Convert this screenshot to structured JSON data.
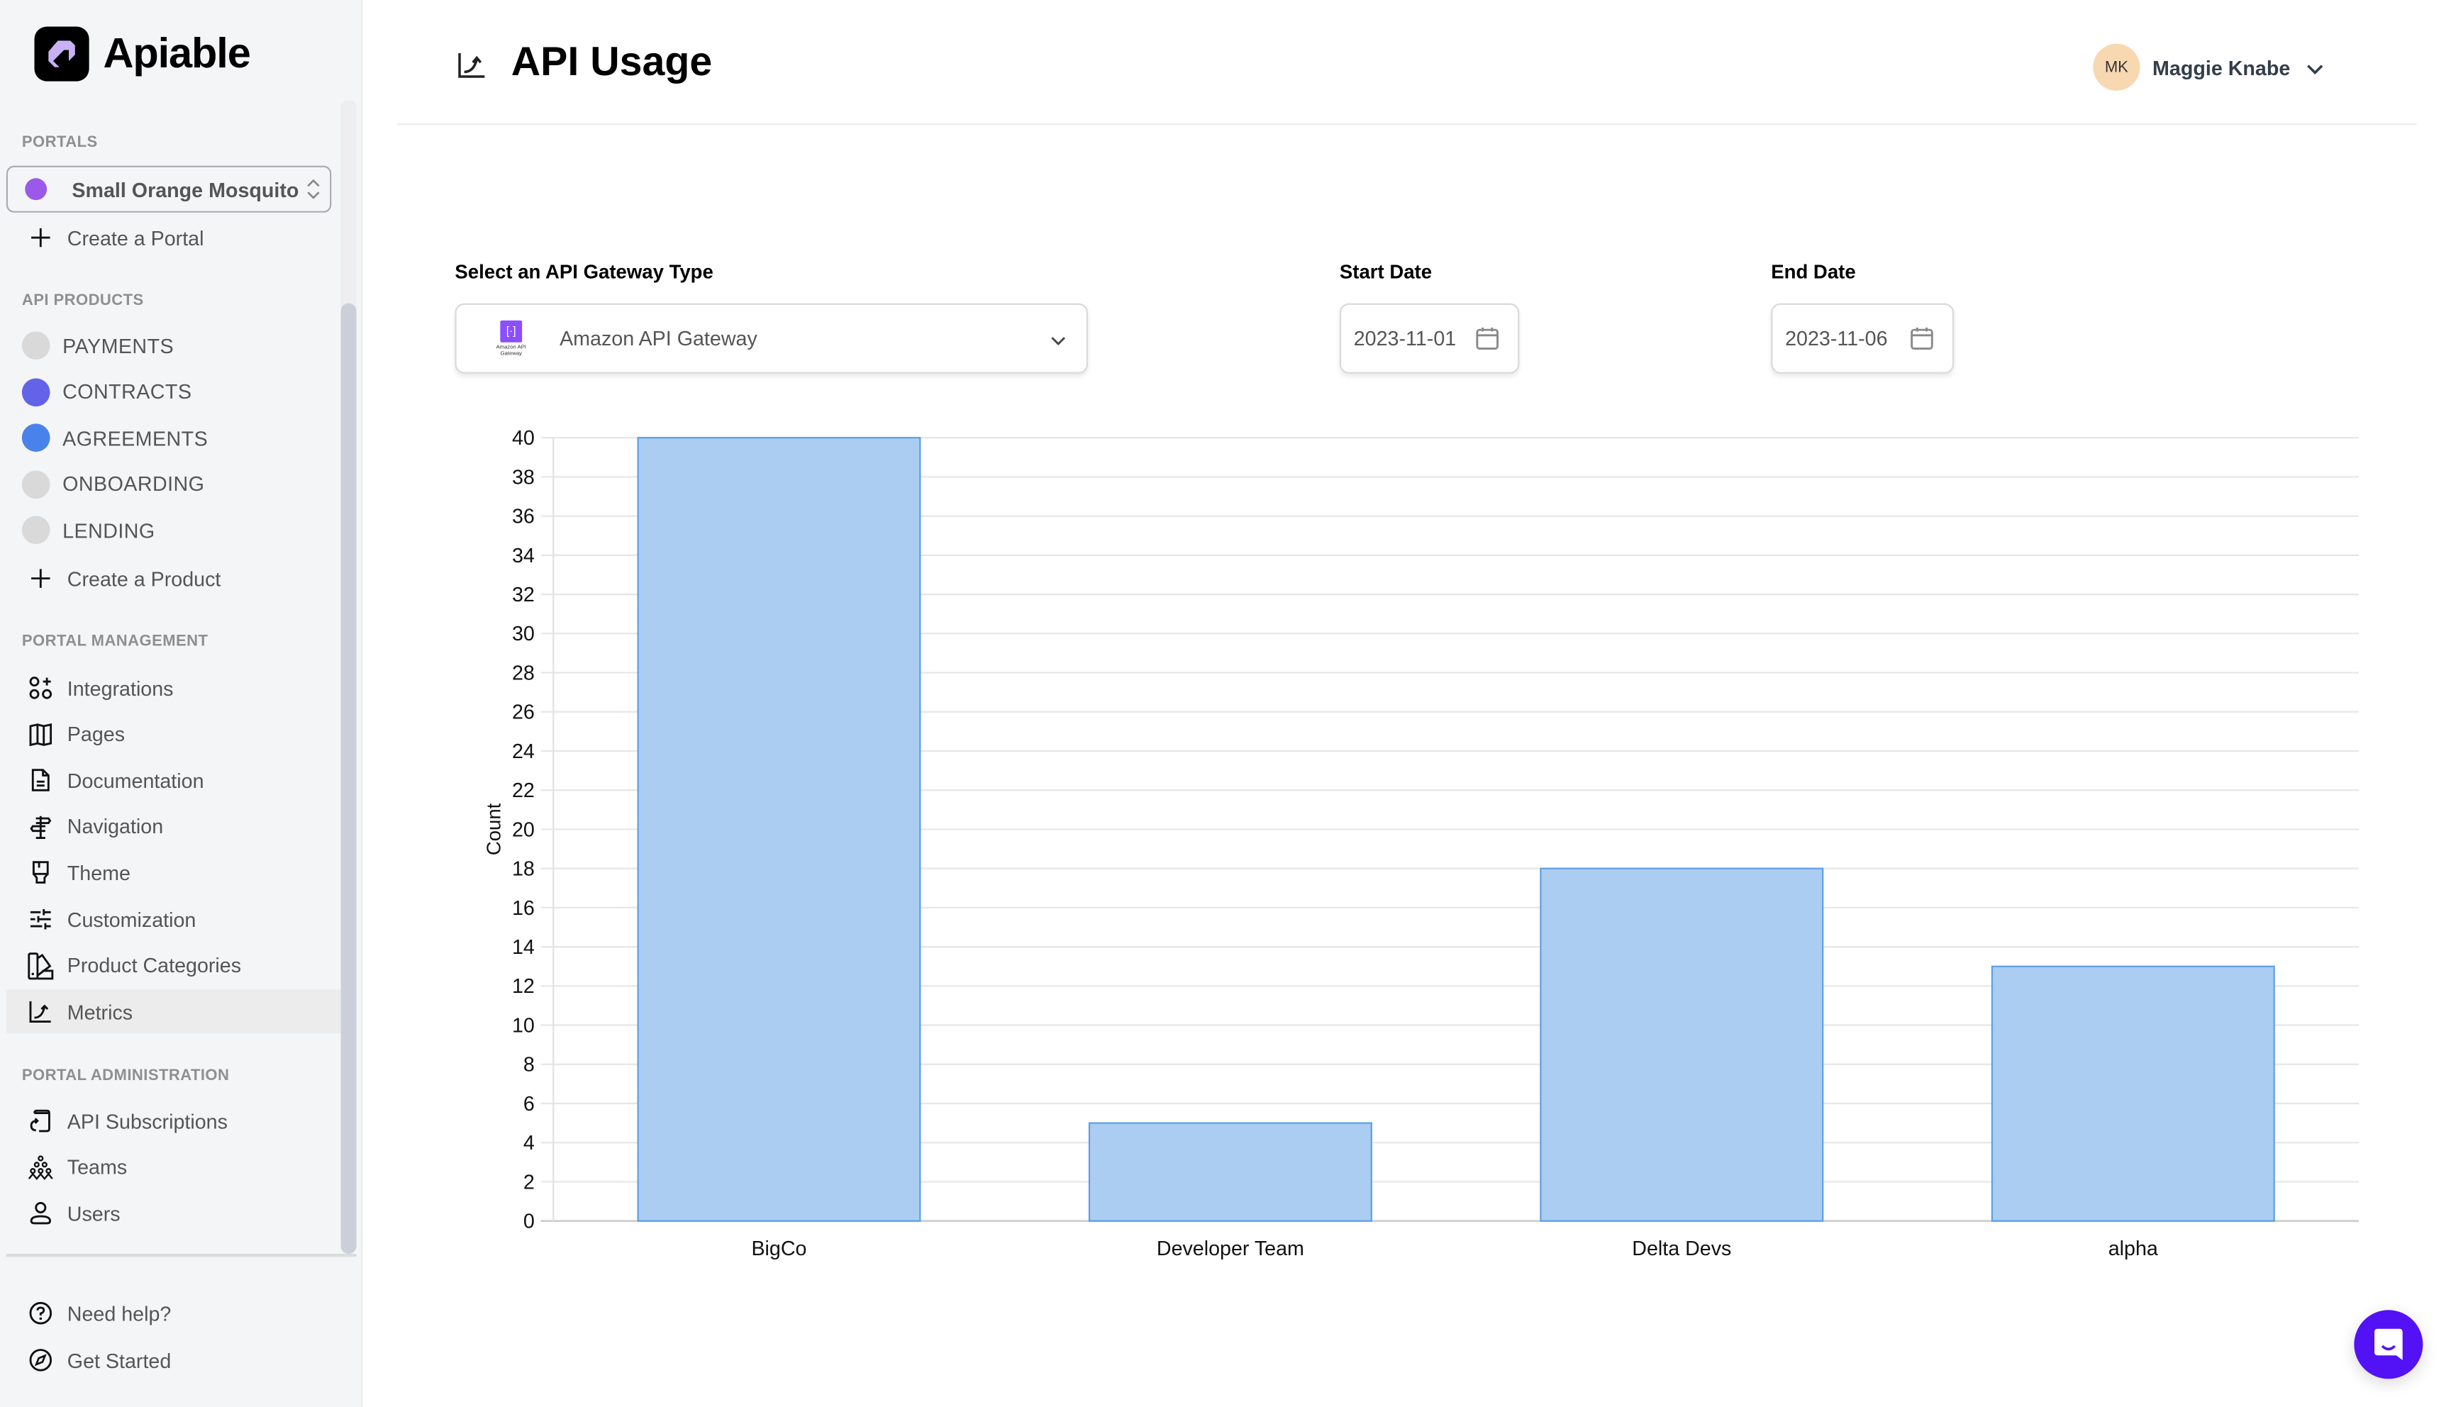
{
  "brand": {
    "name": "Apiable",
    "accent": "#c8b2f5"
  },
  "sidebar": {
    "portals_label": "PORTALS",
    "portal": {
      "name": "Small Orange Mosquito",
      "color": "#9b59ea"
    },
    "create_portal": "Create a Portal",
    "products_label": "API PRODUCTS",
    "products": [
      {
        "label": "PAYMENTS",
        "color": "#d9d9d9"
      },
      {
        "label": "CONTRACTS",
        "color": "#6363e9"
      },
      {
        "label": "AGREEMENTS",
        "color": "#4a82ec"
      },
      {
        "label": "ONBOARDING",
        "color": "#d9d9d9"
      },
      {
        "label": "LENDING",
        "color": "#d9d9d9"
      }
    ],
    "create_product": "Create a Product",
    "management_label": "PORTAL MANAGEMENT",
    "management": [
      {
        "label": "Integrations",
        "icon": "integrations-icon"
      },
      {
        "label": "Pages",
        "icon": "book-open-icon"
      },
      {
        "label": "Documentation",
        "icon": "document-icon"
      },
      {
        "label": "Navigation",
        "icon": "signpost-icon"
      },
      {
        "label": "Theme",
        "icon": "paintbrush-icon"
      },
      {
        "label": "Customization",
        "icon": "sliders-icon"
      },
      {
        "label": "Product Categories",
        "icon": "swatch-icon"
      },
      {
        "label": "Metrics",
        "icon": "chart-up-icon",
        "active": true
      }
    ],
    "administration_label": "PORTAL ADMINISTRATION",
    "administration": [
      {
        "label": "API Subscriptions",
        "icon": "subscriptions-icon"
      },
      {
        "label": "Teams",
        "icon": "teams-icon"
      },
      {
        "label": "Users",
        "icon": "user-icon"
      }
    ],
    "footer": [
      {
        "label": "Need help?",
        "icon": "help-circle-icon"
      },
      {
        "label": "Get Started",
        "icon": "compass-icon"
      }
    ]
  },
  "header": {
    "title": "API Usage",
    "user": {
      "initials": "MK",
      "name": "Maggie Knabe"
    }
  },
  "filters": {
    "gateway_label": "Select an API Gateway Type",
    "gateway_value": "Amazon API Gateway",
    "gateway_logo_text": "Amazon API Gateway",
    "start_label": "Start Date",
    "start_value": "2023-11-01",
    "end_label": "End Date",
    "end_value": "2023-11-06"
  },
  "chart_data": {
    "type": "bar",
    "title": "",
    "xlabel": "",
    "ylabel": "Count",
    "categories": [
      "BigCo",
      "Developer Team",
      "Delta Devs",
      "alpha"
    ],
    "values": [
      40,
      5,
      18,
      13
    ],
    "ylim": [
      0,
      40
    ],
    "ytick_step": 2,
    "grid": true,
    "legend": "none",
    "bar_color": "#abcdf1",
    "bar_border": "#5d9fe6"
  }
}
